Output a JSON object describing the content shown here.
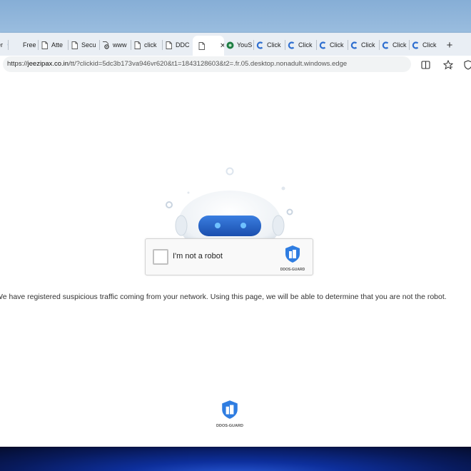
{
  "browser": {
    "tabs": [
      {
        "label": "er",
        "icon": "c-icon"
      },
      {
        "label": "Free",
        "icon": "blank-icon"
      },
      {
        "label": "Atte",
        "icon": "page-icon"
      },
      {
        "label": "Secu",
        "icon": "page-icon"
      },
      {
        "label": "www",
        "icon": "settings-page-icon"
      },
      {
        "label": "click",
        "icon": "page-icon"
      },
      {
        "label": "DDC",
        "icon": "page-icon"
      },
      {
        "label": "",
        "icon": "page-icon",
        "active": true
      },
      {
        "label": "YouS",
        "icon": "green-circle-icon"
      },
      {
        "label": "Click",
        "icon": "blue-c-icon"
      },
      {
        "label": "Click",
        "icon": "blue-c-icon"
      },
      {
        "label": "Click",
        "icon": "blue-c-icon"
      },
      {
        "label": "Click",
        "icon": "blue-c-icon"
      },
      {
        "label": "Click",
        "icon": "blue-c-icon"
      },
      {
        "label": "Click",
        "icon": "blue-c-icon"
      }
    ],
    "close_tab_glyph": "✕",
    "new_tab_glyph": "+",
    "address": {
      "prefix": "https://",
      "domain": "jeezipax.co.in",
      "path": "/tt/?clickid=5dc3b173va946vr620&t1=1843128603&t2=.fr.05.desktop.nonadult.windows.edge"
    }
  },
  "page": {
    "captcha": {
      "label": "I'm not a robot",
      "brand": "DDOS-GUARD"
    },
    "message": "We have registered suspicious traffic coming from your network. Using this page, we will be able to determine that you are not the robot.",
    "footer_brand": "DDOS-GUARD"
  },
  "colors": {
    "accent": "#2f6fd0",
    "shield": "#2f7de1",
    "tabstrip": "#e9eef4"
  }
}
